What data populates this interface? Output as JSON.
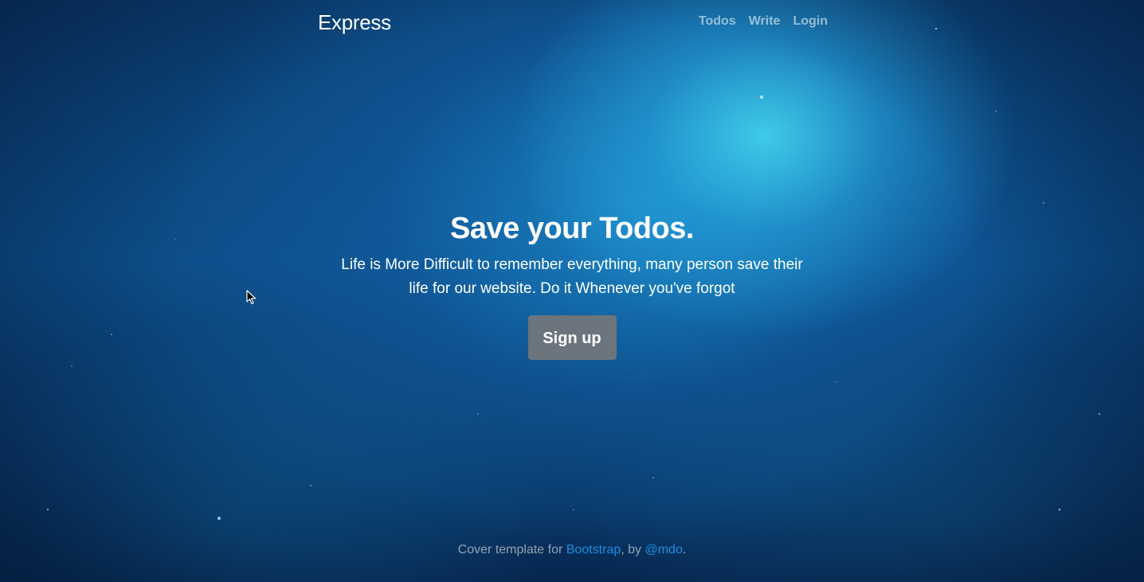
{
  "brand": "Express",
  "nav": {
    "todos": "Todos",
    "write": "Write",
    "login": "Login"
  },
  "hero": {
    "title": "Save your Todos.",
    "lead": "Life is More Difficult to remember everything, many person save their life for our website. Do it Whenever you've forgot",
    "button": "Sign up"
  },
  "footer": {
    "prefix": "Cover template for ",
    "link1": "Bootstrap",
    "middle": ", by ",
    "link2": "@mdo",
    "suffix": "."
  },
  "icons": {
    "cursor": "mouse-pointer-icon"
  },
  "colors": {
    "button_bg": "#6c757d",
    "link": "#1e8ee0",
    "background": "#0d4e8a"
  }
}
